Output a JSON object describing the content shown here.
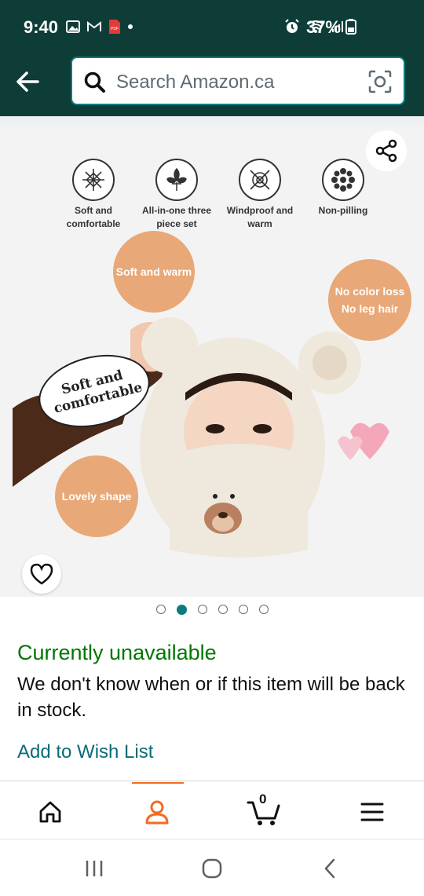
{
  "status_bar": {
    "time": "9:40",
    "battery": "37%"
  },
  "search": {
    "placeholder": "Search Amazon.ca"
  },
  "product": {
    "features": [
      {
        "label": "Soft and comfortable",
        "icon": "snowflake-icon"
      },
      {
        "label": "All-in-one three piece set",
        "icon": "fleur-de-lis-icon"
      },
      {
        "label": "Windproof and warm",
        "icon": "windproof-icon"
      },
      {
        "label": "Non-pilling",
        "icon": "flower-icon"
      }
    ],
    "badges": {
      "soft_warm": "Soft and warm",
      "no_color_loss": "No color loss",
      "no_leg_hair": "No leg hair",
      "lovely_shape": "Lovely shape",
      "soft_comfortable_bubble": "Soft and comfortable"
    },
    "image_count": 6,
    "active_image_index": 1
  },
  "availability": {
    "title": "Currently unavailable",
    "body": "We don't know when or if this item will be back in stock."
  },
  "actions": {
    "wishlist_label": "Add to Wish List"
  },
  "bottom_nav": {
    "cart_count": "0",
    "items": [
      "home-icon",
      "account-icon",
      "cart-icon",
      "menu-icon"
    ]
  },
  "colors": {
    "header_bg": "#0e3d38",
    "accent_teal": "#0a7b81",
    "available_green": "#007600",
    "nav_indicator": "#f36b21",
    "badge_orange": "#e8a877"
  }
}
